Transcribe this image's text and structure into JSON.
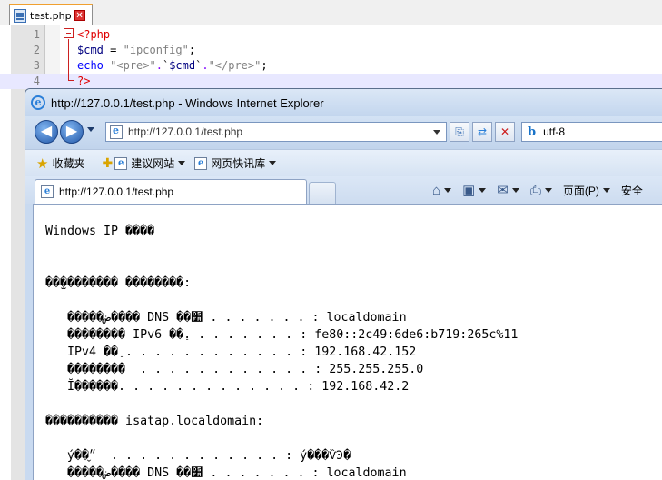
{
  "editor": {
    "tab_name": "test.php",
    "tab_close": "✕",
    "lines": [
      {
        "num": "1",
        "parts": [
          [
            "php",
            "<?php"
          ]
        ]
      },
      {
        "num": "2",
        "parts": [
          [
            "var",
            "$cmd"
          ],
          [
            "plain",
            " = "
          ],
          [
            "str",
            "\"ipconfig\""
          ],
          [
            "plain",
            ";"
          ]
        ]
      },
      {
        "num": "3",
        "parts": [
          [
            "fn",
            "echo"
          ],
          [
            "plain",
            " "
          ],
          [
            "str",
            "\"<pre>\""
          ],
          [
            "op",
            "."
          ],
          [
            "plain",
            "`"
          ],
          [
            "var",
            "$cmd"
          ],
          [
            "plain",
            "`"
          ],
          [
            "op",
            "."
          ],
          [
            "str",
            "\"</pre>\""
          ],
          [
            "plain",
            ";"
          ]
        ]
      },
      {
        "num": "4",
        "parts": [
          [
            "php",
            "?>"
          ]
        ]
      }
    ]
  },
  "ie": {
    "title": "http://127.0.0.1/test.php - Windows Internet Explorer",
    "address": "http://127.0.0.1/test.php",
    "search_text": "utf-8",
    "favorites_label": "收藏夹",
    "suggested_sites": "建议网站",
    "web_slices": "网页快讯库",
    "tab_label": "http://127.0.0.1/test.php",
    "page_menu": "页面(P)",
    "safety_menu": "安全"
  },
  "output_lines": [
    "Windows IP ����",
    "",
    "",
    "��̫�������� ��������:",
    "",
    "   �����ض���� DNS ��׺ . . . . . . . : localdomain",
    "   �������� IPv6 ��ַ. . . . . . . . : fe80::2c49:6de6:b719:265c%11",
    "   IPv4 ��ַ . . . . . . . . . . . . : 192.168.42.152",
    "   ��������  . . . . . . . . . . . . : 255.255.255.0",
    "   Ĭ������. . . . . . . . . . . . . : 192.168.42.2",
    "",
    "���������� isatap.localdomain:",
    "",
    "   ý��״̬  . . . . . . . . . . . . : ý���ѶϿ�",
    "   �����ض���� DNS ��׺ . . . . . . . : localdomain"
  ]
}
